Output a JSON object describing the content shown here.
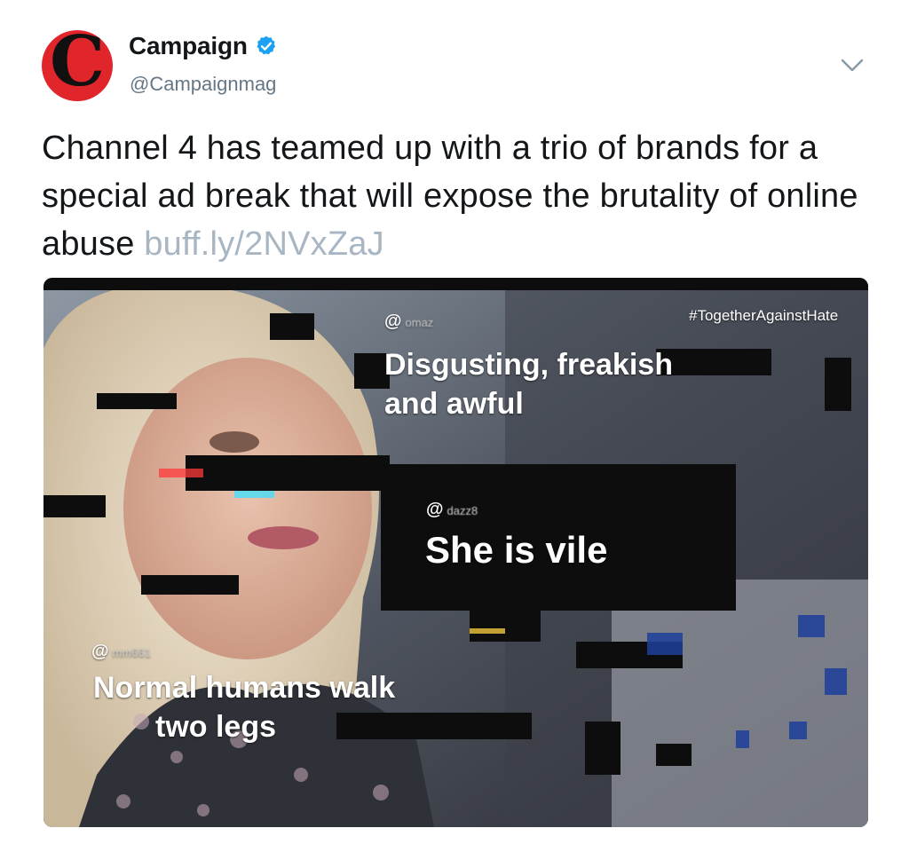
{
  "account": {
    "display_name": "Campaign",
    "handle": "@Campaignmag",
    "avatar_letter": "C",
    "verified": true,
    "brand_color": "#e0252b",
    "verified_color": "#1da1f2"
  },
  "tweet": {
    "text": "Channel 4 has teamed up with a trio of brands for a special ad break that will expose the brutality of online abuse ",
    "link_text": "buff.ly/2NVxZaJ",
    "link_color": "#a8b6c3"
  },
  "menu": {
    "icon": "chevron-down-icon"
  },
  "media": {
    "hashtag": "#TogetherAgainstHate",
    "comments": [
      {
        "at": "@",
        "handle": "omaz",
        "text_line1": "Disgusting, freakish",
        "text_line2": "and awful"
      },
      {
        "at": "@",
        "handle": "dazz8",
        "text_line1": "She is vile"
      },
      {
        "at": "@",
        "handle": "mm661",
        "text_line1": "Normal humans walk",
        "text_line2": "two legs"
      }
    ]
  }
}
